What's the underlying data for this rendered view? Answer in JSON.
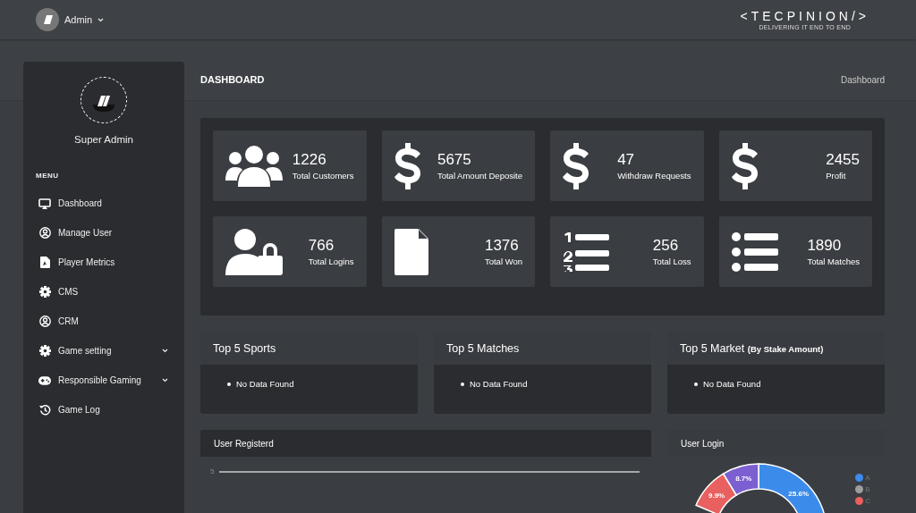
{
  "header": {
    "user": "Admin",
    "logo": "<TECPINION/>",
    "tagline": "DELIVERING IT END TO END"
  },
  "sidebar": {
    "profile_name": "Super Admin",
    "section": "MENU",
    "items": [
      {
        "label": "Dashboard",
        "kind": "link",
        "selected": false
      },
      {
        "label": "Manage User",
        "kind": "link",
        "selected": false
      },
      {
        "label": "Player Metrics",
        "kind": "link",
        "selected": false
      },
      {
        "label": "CMS",
        "kind": "link",
        "selected": false
      },
      {
        "label": "CRM",
        "kind": "link",
        "selected": false
      },
      {
        "label": "Game setting",
        "kind": "group",
        "expanded": false,
        "selected": false
      },
      {
        "label": "Responsible Gaming",
        "kind": "group",
        "expanded": false,
        "selected": false
      },
      {
        "label": "Game Log",
        "kind": "link",
        "selected": false
      }
    ]
  },
  "page": {
    "title": "DASHBOARD",
    "breadcrumb": "Dashboard"
  },
  "stats": [
    {
      "value": "1226",
      "label": "Total Customers"
    },
    {
      "value": "5675",
      "label": "Total Amount Deposite"
    },
    {
      "value": "47",
      "label": "Withdraw Requests"
    },
    {
      "value": "2455",
      "label": "Profit"
    },
    {
      "value": "766",
      "label": "Total Logins"
    },
    {
      "value": "1376",
      "label": "Total Won"
    },
    {
      "value": "256",
      "label": "Total Loss"
    },
    {
      "value": "1890",
      "label": "Total Matches"
    }
  ],
  "top_panels": [
    {
      "title": "Top 5 Sports",
      "items": [
        "No Data Found"
      ]
    },
    {
      "title": "Top 5 Matches",
      "items": [
        "No Data Found"
      ]
    },
    {
      "title": "Top 5 Market **(By Stake Amount)**",
      "items": [
        "No Data Found"
      ]
    }
  ],
  "user_registered": {
    "title": "User Registerd",
    "y_tick": "5"
  },
  "user_login": {
    "title": "User Login",
    "slices": [
      {
        "label": "25.6%",
        "color": "#3b8beb"
      },
      {
        "label": "9.9%",
        "color": "#e8605f"
      },
      {
        "label": "8.7%",
        "color": "#7c5fd0"
      }
    ],
    "legend": [
      {
        "name": "A",
        "color": "#3b8beb"
      },
      {
        "name": "B",
        "color": "#9e9e9e"
      },
      {
        "name": "C",
        "color": "#e8605f"
      }
    ]
  }
}
